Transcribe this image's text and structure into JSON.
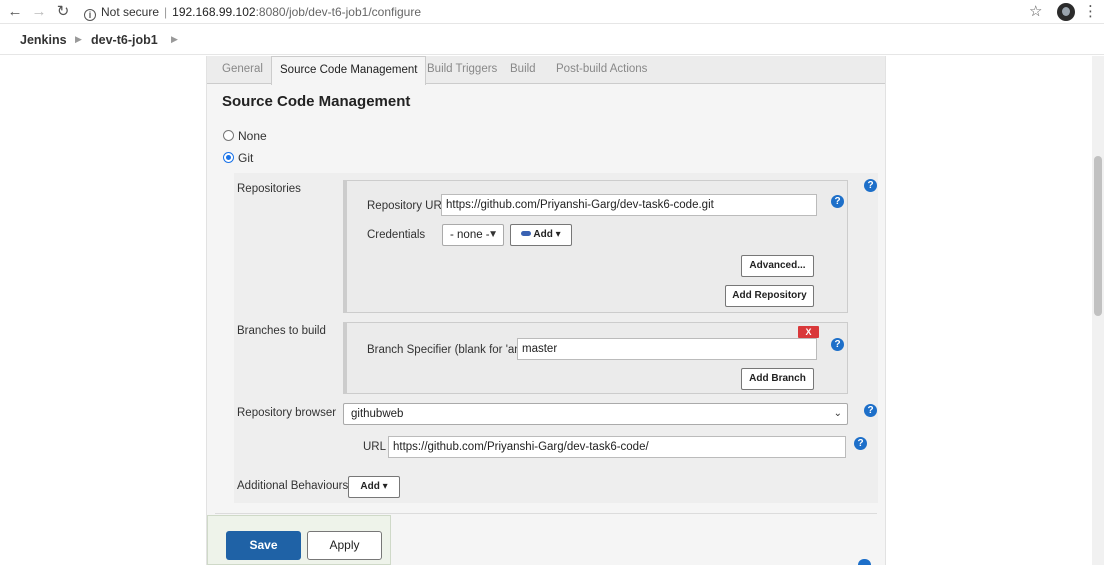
{
  "browser": {
    "security_label": "Not secure",
    "url_host": "192.168.99.102",
    "url_path": ":8080/job/dev-t6-job1/configure"
  },
  "breadcrumb": [
    "Jenkins",
    "dev-t6-job1"
  ],
  "tabs": [
    {
      "label": "General",
      "active": false
    },
    {
      "label": "Source Code Management",
      "active": true
    },
    {
      "label": "Build Triggers",
      "active": false
    },
    {
      "label": "Build",
      "active": false
    },
    {
      "label": "Post-build Actions",
      "active": false
    }
  ],
  "scm": {
    "title": "Source Code Management",
    "options": [
      {
        "label": "None",
        "checked": false
      },
      {
        "label": "Git",
        "checked": true
      }
    ],
    "repositories_label": "Repositories",
    "repo_url_label": "Repository URL",
    "repo_url_value": "https://github.com/Priyanshi-Garg/dev-task6-code.git",
    "credentials_label": "Credentials",
    "credentials_value": "- none -",
    "credentials_add_label": "Add",
    "advanced_label": "Advanced...",
    "add_repository_label": "Add Repository",
    "branches_label": "Branches to build",
    "branch_delete_label": "X",
    "branch_specifier_label": "Branch Specifier (blank for 'any')",
    "branch_specifier_value": "master",
    "add_branch_label": "Add Branch",
    "repo_browser_label": "Repository browser",
    "repo_browser_value": "githubweb",
    "browser_url_label": "URL",
    "browser_url_value": "https://github.com/Priyanshi-Garg/dev-task6-code/",
    "additional_behaviours_label": "Additional Behaviours",
    "additional_add_label": "Add"
  },
  "footer": {
    "save_label": "Save",
    "apply_label": "Apply"
  },
  "icons": {
    "back": "arrow-left-icon",
    "forward": "arrow-right-icon",
    "reload": "reload-icon",
    "info": "info-icon",
    "star": "star-icon",
    "menu": "kebab-menu-icon",
    "help": "help-icon"
  },
  "colors": {
    "primary_button": "#1f62a6",
    "help_icon": "#1d6fc9",
    "delete_button": "#d9383a",
    "radio_checked": "#1a73e8"
  }
}
